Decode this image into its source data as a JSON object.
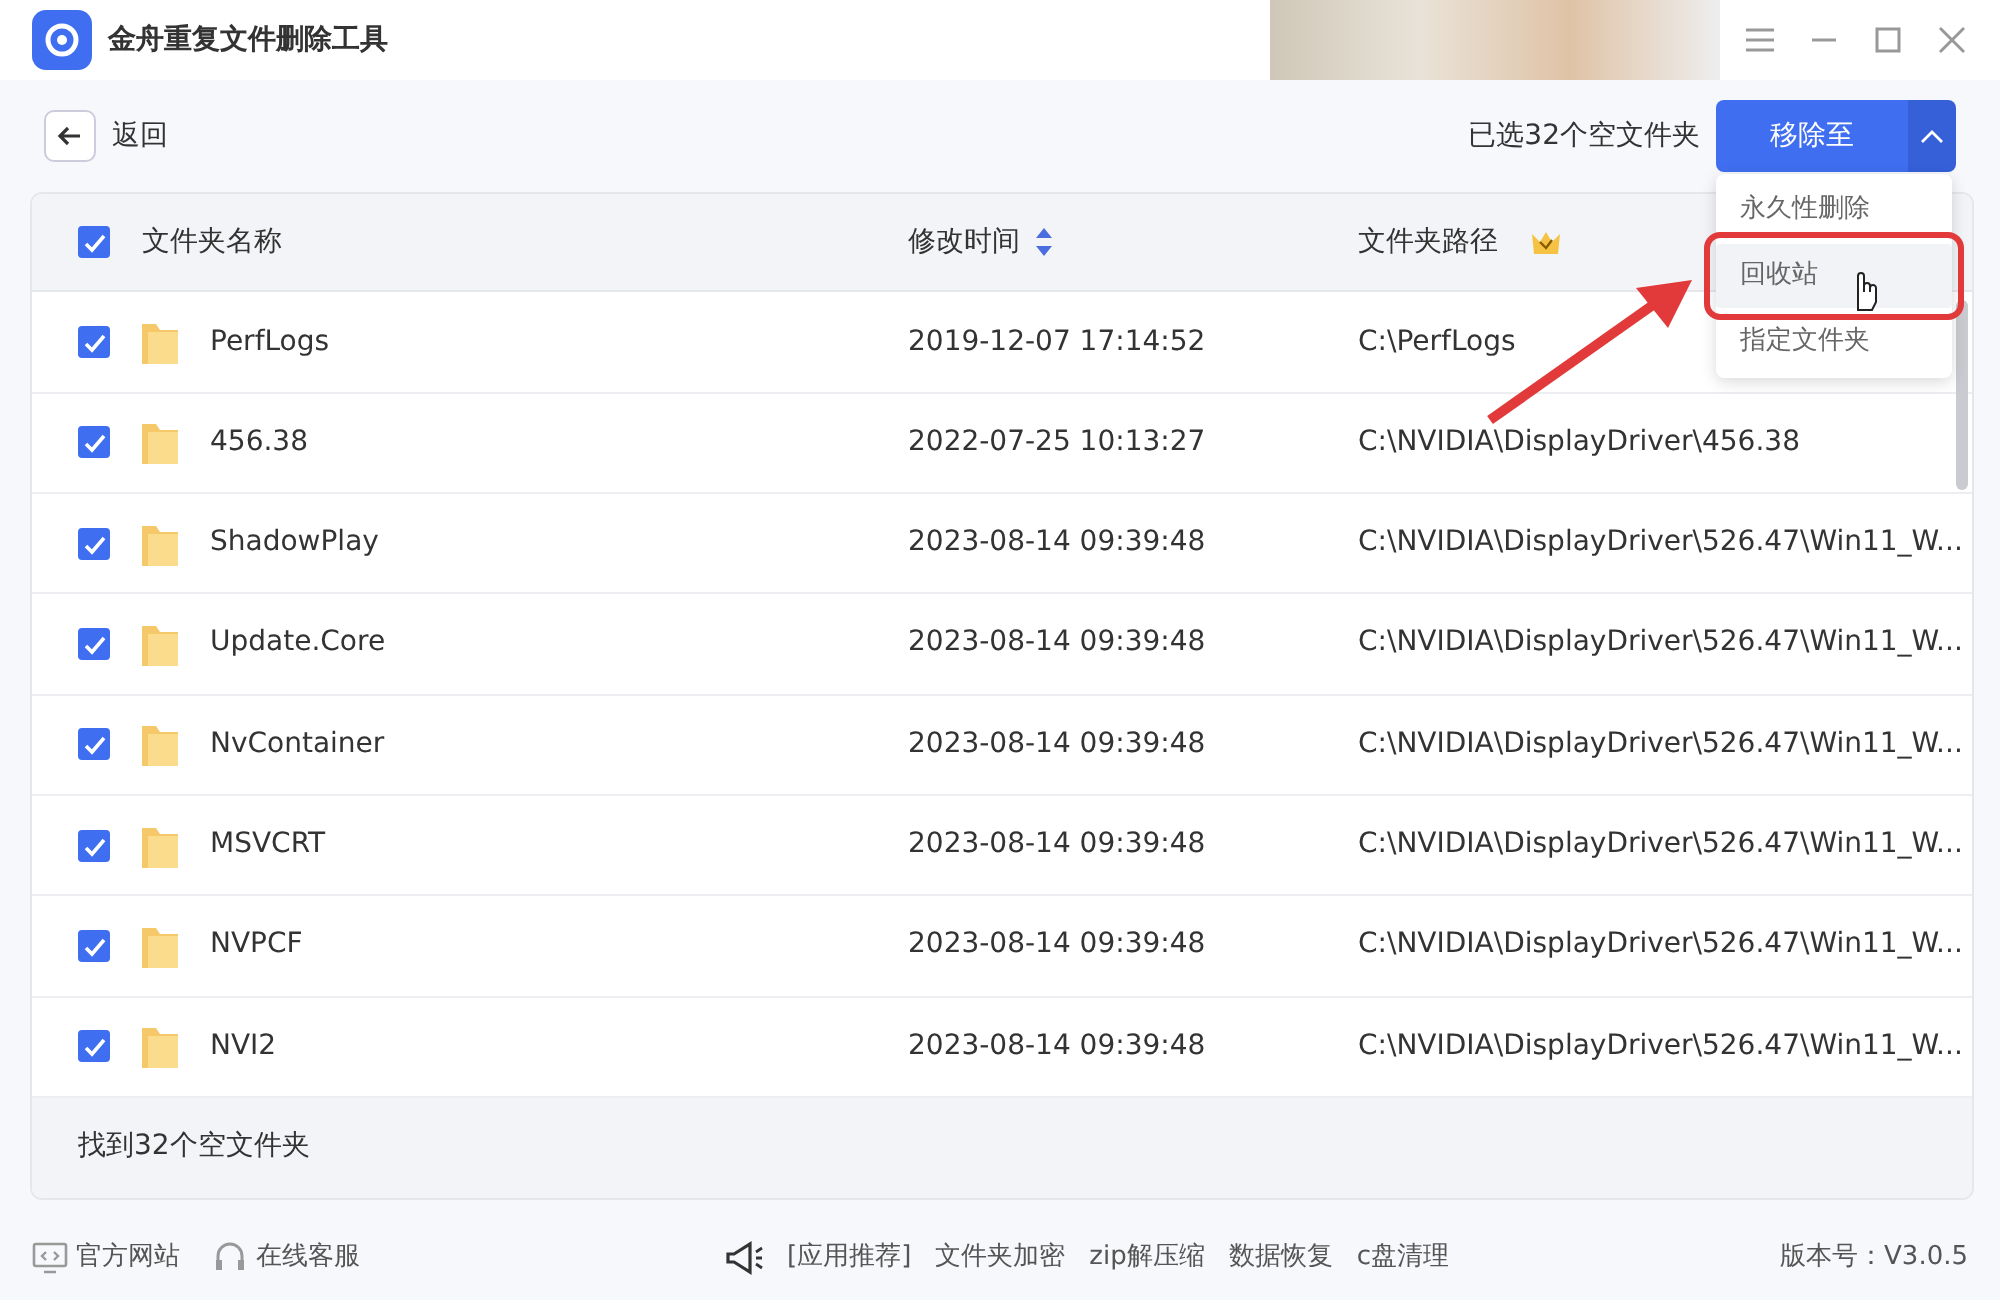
{
  "window": {
    "title": "金舟重复文件删除工具"
  },
  "toolbar": {
    "back": "返回",
    "selected_info": "已选32个空文件夹",
    "move_button": "移除至"
  },
  "menu": [
    {
      "label": "永久性删除",
      "selected": false
    },
    {
      "label": "回收站",
      "selected": true
    },
    {
      "label": "指定文件夹",
      "selected": false
    }
  ],
  "table": {
    "select_all": true,
    "columns": [
      "文件夹名称",
      "修改时间",
      "文件夹路径"
    ],
    "rows": [
      {
        "checked": true,
        "name": "PerfLogs",
        "time": "2019-12-07 17:14:52",
        "path": "C:\\PerfLogs"
      },
      {
        "checked": true,
        "name": "456.38",
        "time": "2022-07-25 10:13:27",
        "path": "C:\\NVIDIA\\DisplayDriver\\456.38"
      },
      {
        "checked": true,
        "name": "ShadowPlay",
        "time": "2023-08-14 09:39:48",
        "path": "C:\\NVIDIA\\DisplayDriver\\526.47\\Win11_W..."
      },
      {
        "checked": true,
        "name": "Update.Core",
        "time": "2023-08-14 09:39:48",
        "path": "C:\\NVIDIA\\DisplayDriver\\526.47\\Win11_W..."
      },
      {
        "checked": true,
        "name": "NvContainer",
        "time": "2023-08-14 09:39:48",
        "path": "C:\\NVIDIA\\DisplayDriver\\526.47\\Win11_W..."
      },
      {
        "checked": true,
        "name": "MSVCRT",
        "time": "2023-08-14 09:39:48",
        "path": "C:\\NVIDIA\\DisplayDriver\\526.47\\Win11_W..."
      },
      {
        "checked": true,
        "name": "NVPCF",
        "time": "2023-08-14 09:39:48",
        "path": "C:\\NVIDIA\\DisplayDriver\\526.47\\Win11_W..."
      },
      {
        "checked": true,
        "name": "NVI2",
        "time": "2023-08-14 09:39:48",
        "path": "C:\\NVIDIA\\DisplayDriver\\526.47\\Win11_W..."
      }
    ],
    "footer": "找到32个空文件夹"
  },
  "status_bar": {
    "left": [
      "官方网站",
      "在线客服"
    ],
    "recommend": [
      "[应用推荐]",
      "文件夹加密",
      "zip解压缩",
      "数据恢复",
      "c盘清理"
    ],
    "version": "版本号：V3.0.5"
  }
}
